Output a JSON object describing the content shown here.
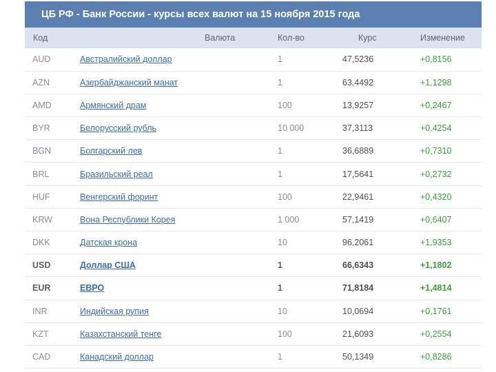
{
  "page": {
    "title": "ЦБ РФ - Банк России - курсы всех валют на 15 ноября 2015 года"
  },
  "table": {
    "headers": {
      "code": "Код",
      "currency": "Валюта",
      "quantity": "Кол-во",
      "rate": "Курс",
      "change": "Изменение"
    },
    "rows": [
      {
        "code": "AUD",
        "name": "Австралийский доллар",
        "qty": "1",
        "rate": "47,5236",
        "change": "+0,8156",
        "bold": false
      },
      {
        "code": "AZN",
        "name": "Азербайджанский манат",
        "qty": "1",
        "rate": "63,4492",
        "change": "+1,1298",
        "bold": false
      },
      {
        "code": "AMD",
        "name": "Армянский драм",
        "qty": "100",
        "rate": "13,9257",
        "change": "+0,2467",
        "bold": false
      },
      {
        "code": "BYR",
        "name": "Белорусский рубль",
        "qty": "10 000",
        "rate": "37,3113",
        "change": "+0,4254",
        "bold": false
      },
      {
        "code": "BGN",
        "name": "Болгарский лев",
        "qty": "1",
        "rate": "36,6889",
        "change": "+0,7310",
        "bold": false
      },
      {
        "code": "BRL",
        "name": "Бразильский реал",
        "qty": "1",
        "rate": "17,5641",
        "change": "+0,2732",
        "bold": false
      },
      {
        "code": "HUF",
        "name": "Венгерский форинт",
        "qty": "100",
        "rate": "22,9461",
        "change": "+0,4320",
        "bold": false
      },
      {
        "code": "KRW",
        "name": "Вона Республики Корея",
        "qty": "1 000",
        "rate": "57,1419",
        "change": "+0,6407",
        "bold": false
      },
      {
        "code": "DKK",
        "name": "Датская крона",
        "qty": "10",
        "rate": "96,2061",
        "change": "+1,9353",
        "bold": false
      },
      {
        "code": "USD",
        "name": "Доллар США",
        "qty": "1",
        "rate": "66,6343",
        "change": "+1,1802",
        "bold": true
      },
      {
        "code": "EUR",
        "name": "ЕВРО",
        "qty": "1",
        "rate": "71,8184",
        "change": "+1,4814",
        "bold": true
      },
      {
        "code": "INR",
        "name": "Индийская рупия",
        "qty": "10",
        "rate": "10,0694",
        "change": "+0,1761",
        "bold": false
      },
      {
        "code": "KZT",
        "name": "Казахстанский тенге",
        "qty": "100",
        "rate": "21,6093",
        "change": "+0,2554",
        "bold": false
      },
      {
        "code": "CAD",
        "name": "Канадский доллар",
        "qty": "1",
        "rate": "50,1349",
        "change": "+0,8286",
        "bold": false
      }
    ]
  },
  "colors": {
    "title_bar": "#5a7fb0",
    "header_row": "#dde3ee",
    "link": "#3a6db3",
    "positive_change": "#3aa13a"
  }
}
